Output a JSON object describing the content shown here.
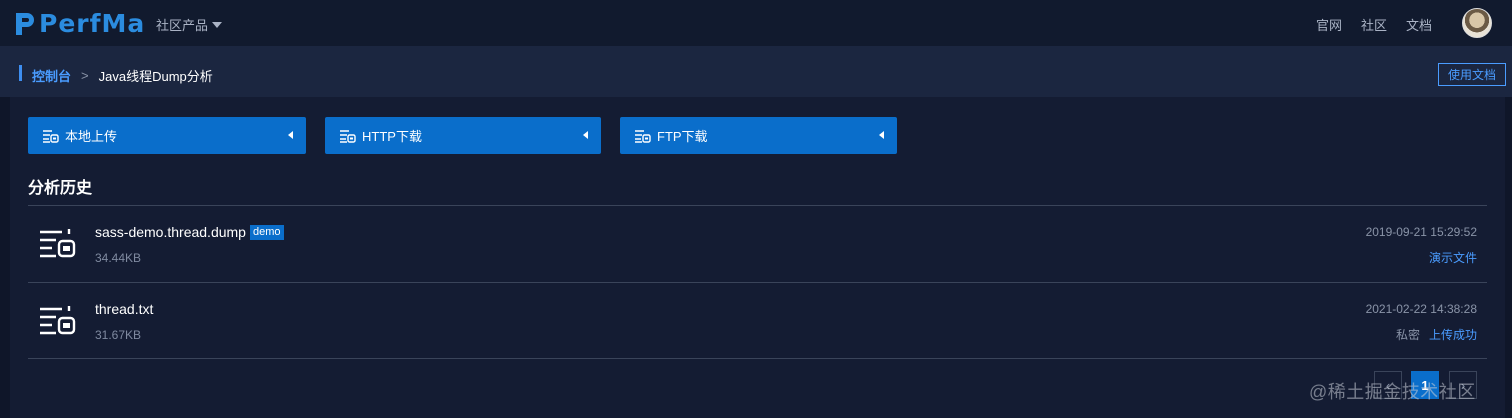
{
  "brand": {
    "logo_text": "PerfMa",
    "accent": "#2b8cdf"
  },
  "topnav": {
    "product_menu": "社区产品",
    "links": [
      "官网",
      "社区",
      "文档"
    ]
  },
  "breadcrumb": {
    "root": "控制台",
    "separator": ">",
    "current": "Java线程Dump分析",
    "doc_button": "使用文档"
  },
  "upload": {
    "local": "本地上传",
    "http": "HTTP下载",
    "ftp": "FTP下载"
  },
  "history": {
    "title": "分析历史",
    "items": [
      {
        "name": "sass-demo.thread.dump",
        "tag": "demo",
        "size": "34.44KB",
        "date": "2019-09-21 15:29:52",
        "status_private": "",
        "status_link": "演示文件"
      },
      {
        "name": "thread.txt",
        "tag": "",
        "size": "31.67KB",
        "date": "2021-02-22 14:38:28",
        "status_private": "私密",
        "status_link": "上传成功"
      }
    ]
  },
  "pagination": {
    "prev": "‹",
    "page": "1",
    "next": "›"
  },
  "watermark": "@稀土掘金技术社区",
  "colors": {
    "primary_blue": "#0a6ecb",
    "link_blue": "#4a9cff",
    "background": "#0f1629"
  }
}
